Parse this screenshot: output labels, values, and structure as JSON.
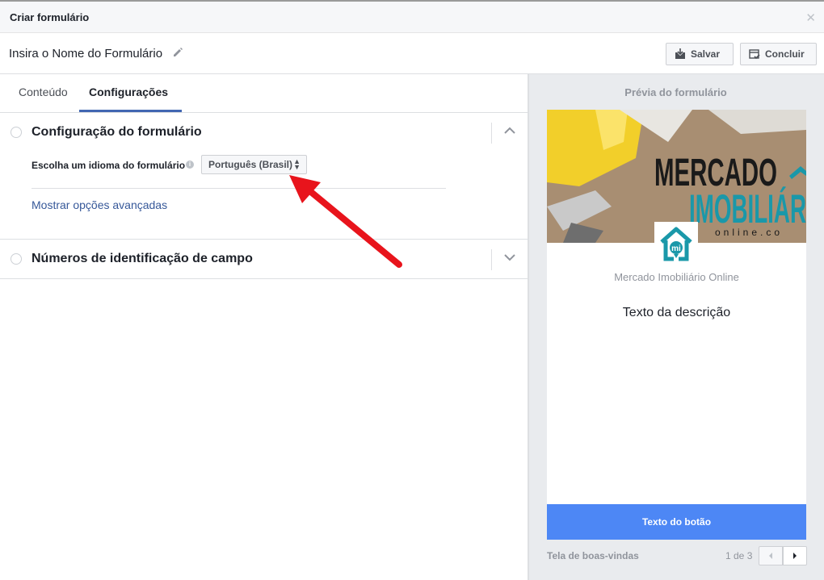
{
  "dialog": {
    "title": "Criar formulário",
    "close_icon": "close-icon"
  },
  "form_name": {
    "text": "Insira o Nome do Formulário",
    "edit_icon": "pencil-icon"
  },
  "actions": {
    "save_label": "Salvar",
    "done_label": "Concluir"
  },
  "tabs": [
    {
      "label": "Conteúdo",
      "active": false
    },
    {
      "label": "Configurações",
      "active": true
    }
  ],
  "sections": {
    "config": {
      "title": "Configuração do formulário",
      "expanded": true,
      "language_label": "Escolha um idioma do formulário",
      "language_value": "Português (Brasil)",
      "advanced_link": "Mostrar opções avançadas"
    },
    "field_ids": {
      "title": "Números de identificação de campo",
      "expanded": false
    }
  },
  "preview": {
    "title": "Prévia do formulário",
    "cover_text_1": "MERCADO",
    "cover_text_2": "IMOBILIÁR",
    "cover_text_3": "online.co",
    "logo_text": "mi",
    "page_name": "Mercado Imobiliário Online",
    "description": "Texto da descrição",
    "button_label": "Texto do botão",
    "screen_label": "Tela de boas-vindas",
    "pager": "1 de 3"
  },
  "colors": {
    "accent": "#4267b2",
    "link": "#365899",
    "cta": "#4d87f5",
    "annotation_arrow": "#e8141c",
    "brand_teal": "#1a98a9"
  }
}
